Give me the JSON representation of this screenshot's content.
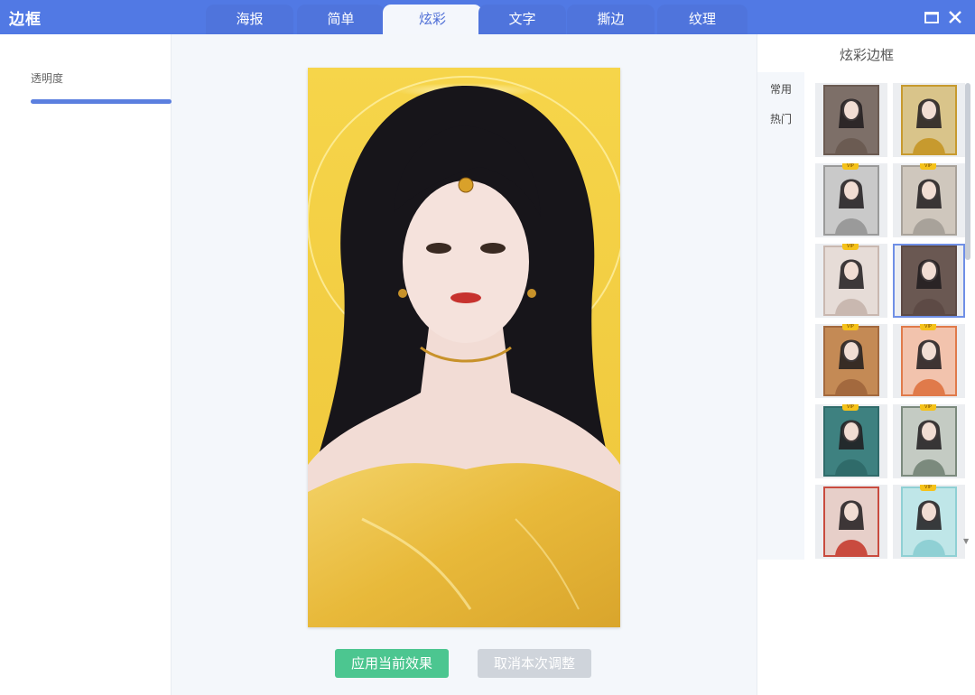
{
  "window": {
    "title": "边框"
  },
  "tabs": [
    {
      "label": "海报",
      "active": false
    },
    {
      "label": "简单",
      "active": false
    },
    {
      "label": "炫彩",
      "active": true
    },
    {
      "label": "文字",
      "active": false
    },
    {
      "label": "撕边",
      "active": false
    },
    {
      "label": "纹理",
      "active": false
    }
  ],
  "left_panel": {
    "opacity_label": "透明度",
    "opacity_value": 1.0
  },
  "actions": {
    "apply_label": "应用当前效果",
    "cancel_label": "取消本次调整"
  },
  "right_panel": {
    "title": "炫彩边框",
    "categories": [
      "常用",
      "热门"
    ],
    "thumbnails": [
      {
        "vip": false,
        "selected": false,
        "frame_color": "#6b5b52",
        "bg": "#7d6f68"
      },
      {
        "vip": false,
        "selected": false,
        "frame_color": "#c79a2e",
        "bg": "#d9c48a"
      },
      {
        "vip": true,
        "vip_text": "VIP",
        "selected": false,
        "frame_color": "#9a9a9a",
        "bg": "#c9c9c9"
      },
      {
        "vip": true,
        "vip_text": "VIP",
        "selected": false,
        "frame_color": "#a8a29a",
        "bg": "#cfc7bd"
      },
      {
        "vip": true,
        "vip_text": "VIP",
        "selected": false,
        "frame_color": "#c9b8b0",
        "bg": "#e6dcd7"
      },
      {
        "vip": false,
        "selected": true,
        "frame_color": "#5d4a45",
        "bg": "#6a5852"
      },
      {
        "vip": true,
        "vip_text": "VIP",
        "selected": false,
        "frame_color": "#a3693e",
        "bg": "#c48a55"
      },
      {
        "vip": true,
        "vip_text": "VIP",
        "selected": false,
        "frame_color": "#e07a4a",
        "bg": "#f2c3ad"
      },
      {
        "vip": true,
        "vip_text": "VIP",
        "selected": false,
        "frame_color": "#2f6b6a",
        "bg": "#3e8180"
      },
      {
        "vip": true,
        "vip_text": "VIP",
        "selected": false,
        "frame_color": "#7b8a7d",
        "bg": "#c4cbc3"
      },
      {
        "vip": false,
        "selected": false,
        "frame_color": "#c94b3f",
        "bg": "#e7cfc9"
      },
      {
        "vip": true,
        "vip_text": "VIP",
        "selected": false,
        "frame_color": "#8fd0d4",
        "bg": "#bfe6e8"
      }
    ]
  },
  "colors": {
    "titlebar": "#5179e4",
    "accent": "#5b7fdf",
    "apply": "#4cc690",
    "cancel": "#cfd4db",
    "preview_bg": "#f0cc3e"
  }
}
